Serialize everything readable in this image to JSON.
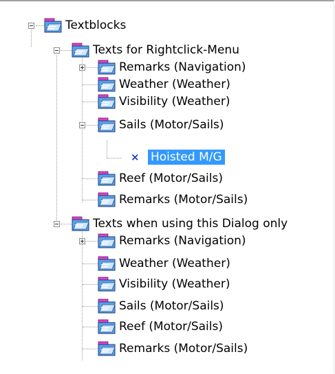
{
  "tree": {
    "root": {
      "label": "Textblocks"
    },
    "groups": [
      {
        "label": "Texts for Rightclick-Menu",
        "items": [
          {
            "label": "Remarks (Navigation)",
            "expander": "plus"
          },
          {
            "label": "Weather (Weather)"
          },
          {
            "label": "Visibility (Weather)"
          },
          {
            "label": "Sails (Motor/Sails)",
            "expander": "minus",
            "children": [
              {
                "label": "Hoisted M/G",
                "icon": "x-icon",
                "selected": true
              }
            ]
          },
          {
            "label": "Reef (Motor/Sails)"
          },
          {
            "label": "Remarks (Motor/Sails)"
          }
        ]
      },
      {
        "label": "Texts when using this Dialog only",
        "items": [
          {
            "label": "Remarks (Navigation)",
            "expander": "plus"
          },
          {
            "label": "Weather (Weather)"
          },
          {
            "label": "Visibility (Weather)"
          },
          {
            "label": "Sails (Motor/Sails)"
          },
          {
            "label": "Reef (Motor/Sails)"
          },
          {
            "label": "Remarks (Motor/Sails)"
          }
        ]
      }
    ]
  },
  "colors": {
    "selection": "#3399ff",
    "folder_body": "#5aa0e8",
    "folder_accent": "#e040c8",
    "leaf_icon": "#1a3fc2"
  }
}
